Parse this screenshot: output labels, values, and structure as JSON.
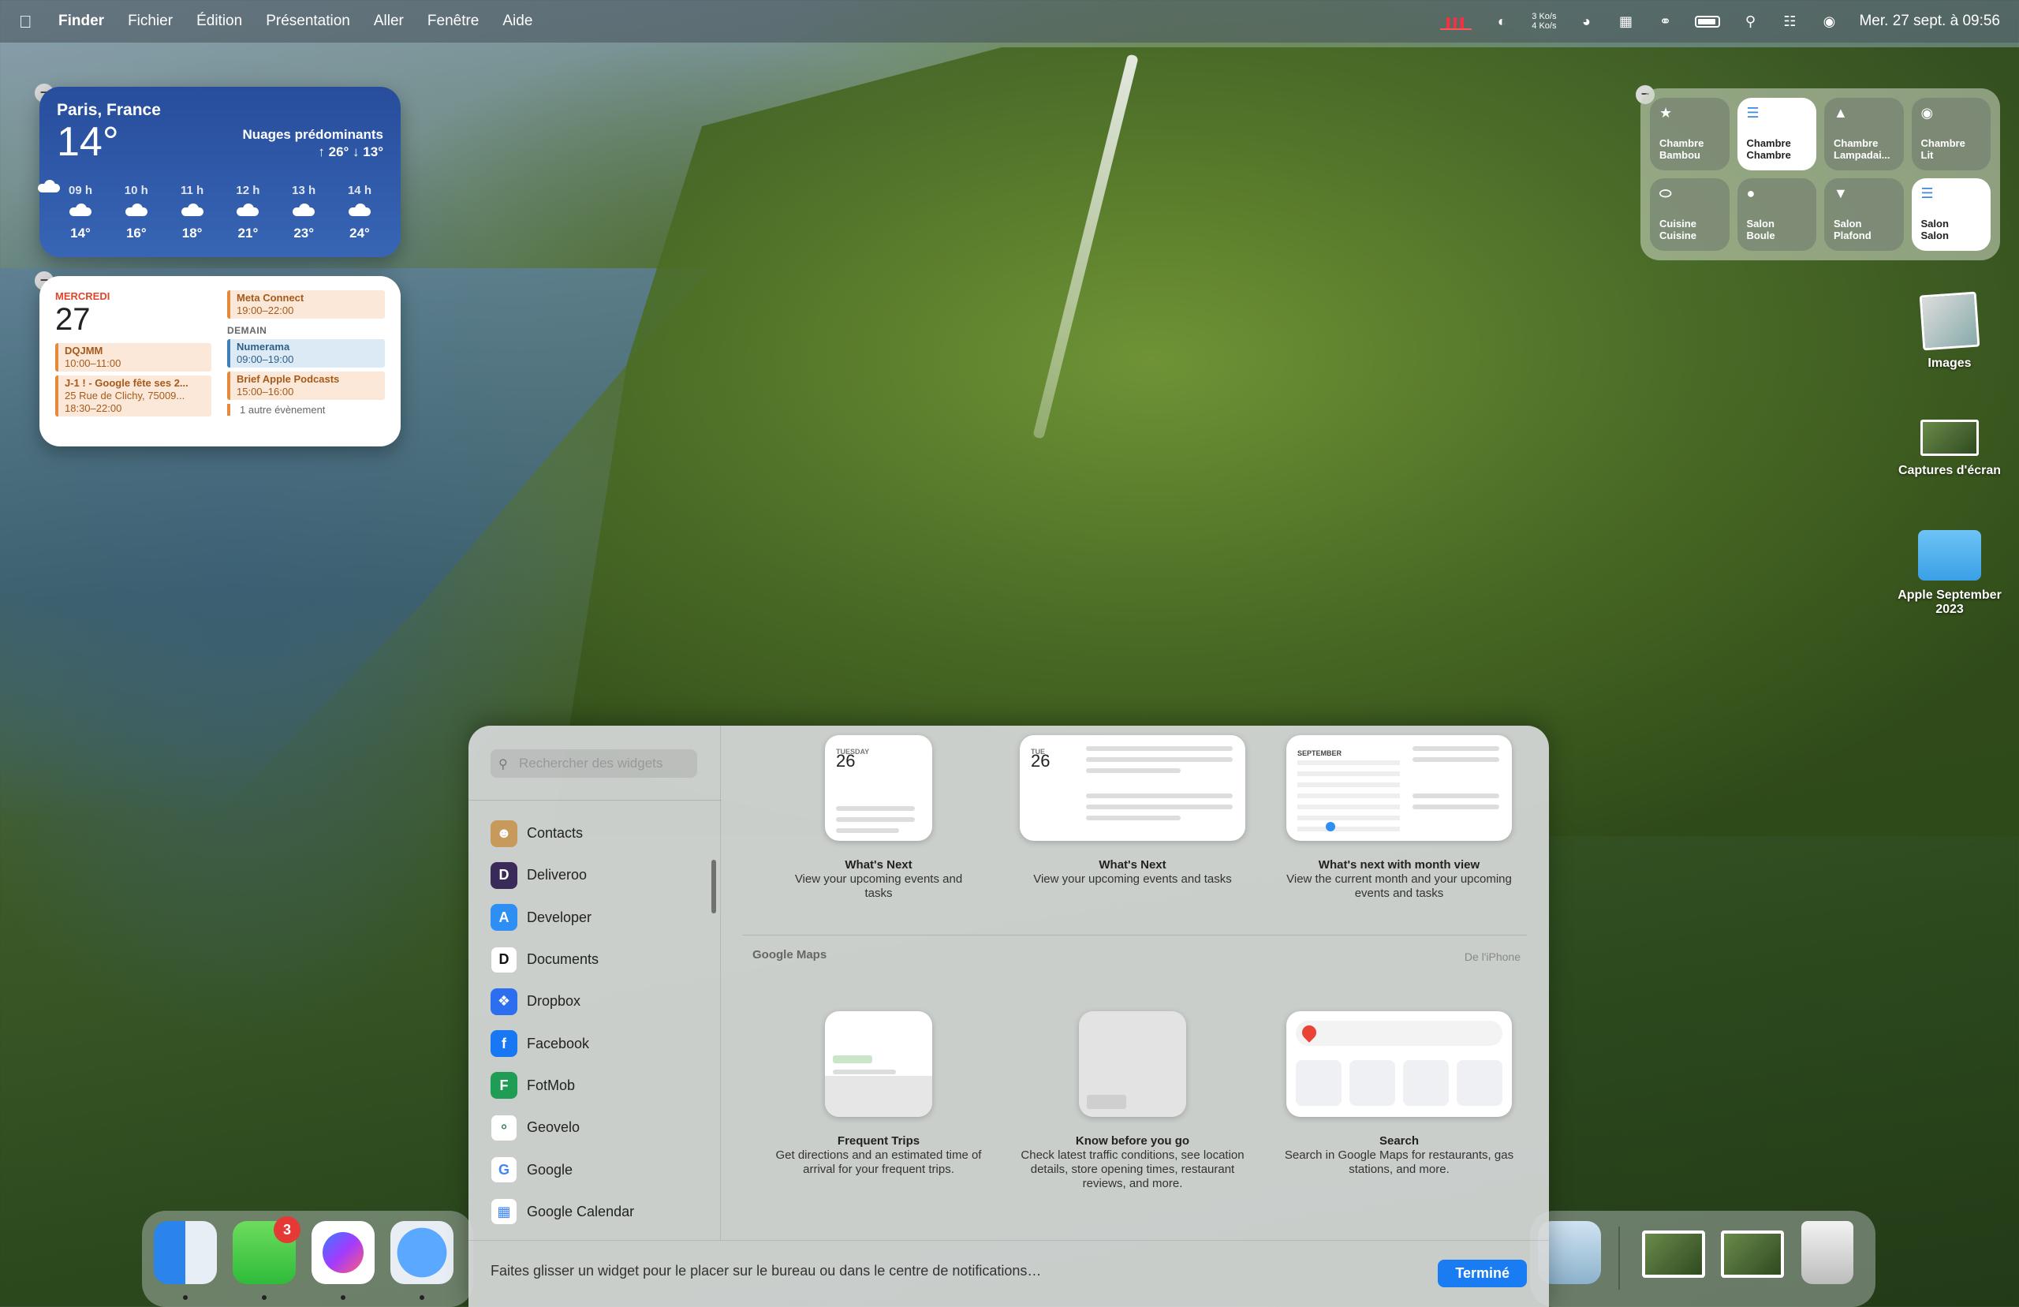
{
  "menubar": {
    "app": "Finder",
    "items": [
      "Fichier",
      "Édition",
      "Présentation",
      "Aller",
      "Fenêtre",
      "Aide"
    ],
    "net_up": "3 Ko/s",
    "net_down": "4 Ko/s",
    "clock": "Mer. 27 sept. à 09:56"
  },
  "weather": {
    "city": "Paris, France",
    "temp": "14°",
    "condition": "Nuages prédominants",
    "hilo": "↑ 26° ↓ 13°",
    "hours": [
      {
        "label": "09 h",
        "temp": "14°"
      },
      {
        "label": "10 h",
        "temp": "16°"
      },
      {
        "label": "11 h",
        "temp": "18°"
      },
      {
        "label": "12 h",
        "temp": "21°"
      },
      {
        "label": "13 h",
        "temp": "23°"
      },
      {
        "label": "14 h",
        "temp": "24°"
      }
    ]
  },
  "calendar": {
    "day": "MERCREDI",
    "date": "27",
    "today_events": [
      {
        "title": "DQJMM",
        "time": "10:00–11:00"
      },
      {
        "title": "J-1 ! - Google fête ses 2...",
        "detail": "25 Rue de Clichy, 75009...",
        "time": "18:30–22:00"
      }
    ],
    "right_top_event": {
      "title": "Meta Connect",
      "time": "19:00–22:00"
    },
    "tomorrow_label": "DEMAIN",
    "tomorrow_events": [
      {
        "title": "Numerama",
        "time": "09:00–19:00"
      },
      {
        "title": "Brief Apple Podcasts",
        "time": "15:00–16:00"
      }
    ],
    "more": "1 autre évènement"
  },
  "home": {
    "tiles": [
      {
        "line1": "Chambre",
        "line2": "Bambou"
      },
      {
        "line1": "Chambre",
        "line2": "Chambre"
      },
      {
        "line1": "Chambre",
        "line2": "Lampadai..."
      },
      {
        "line1": "Chambre",
        "line2": "Lit"
      },
      {
        "line1": "Cuisine",
        "line2": "Cuisine"
      },
      {
        "line1": "Salon",
        "line2": "Boule"
      },
      {
        "line1": "Salon",
        "line2": "Plafond"
      },
      {
        "line1": "Salon",
        "line2": "Salon"
      }
    ]
  },
  "desktop": {
    "images": "Images",
    "screenshots": "Captures d'écran",
    "folder": "Apple September 2023"
  },
  "gallery": {
    "search_placeholder": "Rechercher des widgets",
    "apps": [
      "Contacts",
      "Deliveroo",
      "Developer",
      "Documents",
      "Dropbox",
      "Facebook",
      "FotMob",
      "Geovelo",
      "Google",
      "Google Calendar"
    ],
    "calendar_widgets": [
      {
        "title": "What's Next",
        "desc": "View your upcoming events and tasks",
        "preview_day": "TUESDAY",
        "preview_date": "26"
      },
      {
        "title": "What's Next",
        "desc": "View your upcoming events and tasks",
        "preview_day": "TUE",
        "preview_date": "26"
      },
      {
        "title": "What's next with month view",
        "desc": "View the current month and your upcoming events and tasks",
        "preview_month": "SEPTEMBER"
      }
    ],
    "section_title": "Google Maps",
    "section_source": "De l'iPhone",
    "maps_widgets": [
      {
        "title": "Frequent Trips",
        "desc": "Get directions and an estimated time of arrival for your frequent trips."
      },
      {
        "title": "Know before you go",
        "desc": "Check latest traffic conditions, see location details, store opening times, restaurant reviews, and more."
      },
      {
        "title": "Search",
        "desc": "Search in Google Maps for restaurants, gas stations, and more."
      }
    ],
    "hint": "Faites glisser un widget pour le placer sur le bureau ou dans le centre de notifications…",
    "done": "Terminé"
  },
  "dock": {
    "messages_badge": "3"
  },
  "colors": {
    "accent": "#1a7cf2",
    "weather_bg": "#2f5aa8",
    "calendar_red": "#e0452c"
  }
}
